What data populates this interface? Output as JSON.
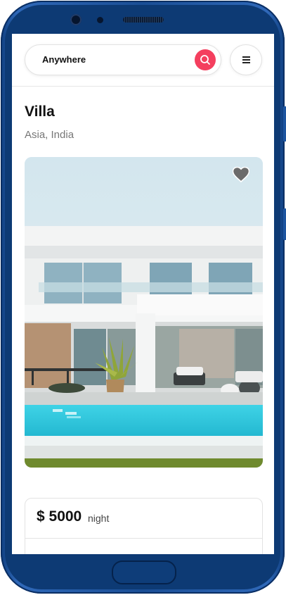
{
  "search": {
    "label": "Anywhere"
  },
  "listing": {
    "title": "Villa",
    "location": "Asia, India"
  },
  "pricing": {
    "price": "$ 5000",
    "unit": "night"
  },
  "colors": {
    "accent": "#f43f5e",
    "device_frame": "#1a4e95"
  },
  "icons": {
    "search": "search-icon",
    "menu": "menu-icon",
    "favorite": "heart-icon"
  }
}
